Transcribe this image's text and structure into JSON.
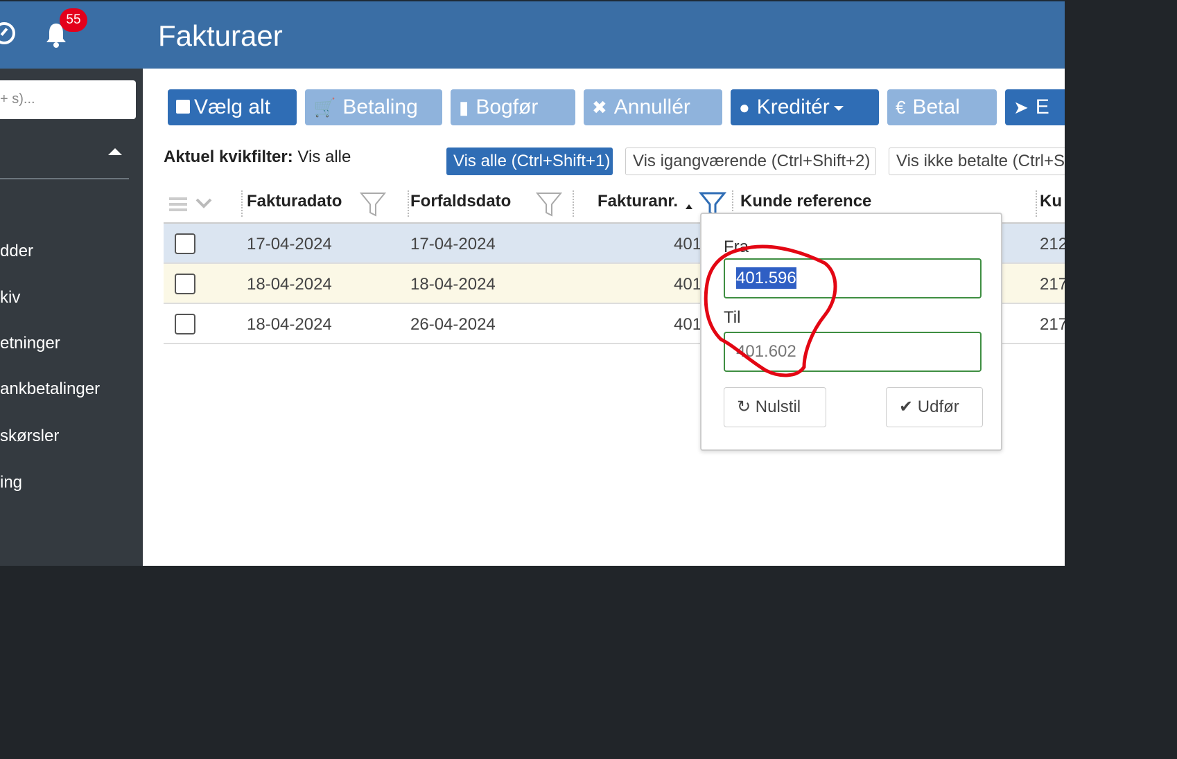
{
  "header": {
    "title": "Fakturaer",
    "notification_count": "55"
  },
  "sidebar": {
    "search_placeholder": "+ s)...",
    "items": [
      "dder",
      "kiv",
      "etninger",
      "ankbetalinger",
      "skørsler",
      "ing"
    ]
  },
  "toolbar": {
    "select_all": "Vælg alt",
    "payment": "Betaling",
    "post": "Bogfør",
    "cancel": "Annullér",
    "credit": "Kreditér",
    "pay": "Betal",
    "send": "E"
  },
  "quickfilter": {
    "label": "Aktuel kvikfilter:",
    "current": "Vis alle",
    "options": [
      "Vis alle (Ctrl+Shift+1)",
      "Vis igangværende (Ctrl+Shift+2)",
      "Vis ikke betalte (Ctrl+S"
    ]
  },
  "table": {
    "columns": [
      "Fakturadato",
      "Forfaldsdato",
      "Fakturanr.",
      "Kunde reference",
      "Ku"
    ],
    "rows": [
      {
        "invoice_date": "17-04-2024",
        "due_date": "17-04-2024",
        "invoice_no": "401",
        "customer_ref": "212"
      },
      {
        "invoice_date": "18-04-2024",
        "due_date": "18-04-2024",
        "invoice_no": "401",
        "customer_ref": "217"
      },
      {
        "invoice_date": "18-04-2024",
        "due_date": "26-04-2024",
        "invoice_no": "401",
        "customer_ref": "217"
      }
    ]
  },
  "range_filter": {
    "from_label": "Fra",
    "from_value": "401.596",
    "to_label": "Til",
    "to_value": "401.602",
    "reset_label": "Nulstil",
    "apply_label": "Udfør"
  },
  "colors": {
    "header_bg": "#3a6ea5",
    "sidebar_bg": "#343a40",
    "primary_button": "#2f6db5",
    "light_button": "#8fb3dc",
    "badge": "#e3001b",
    "annotation": "#e30613"
  }
}
